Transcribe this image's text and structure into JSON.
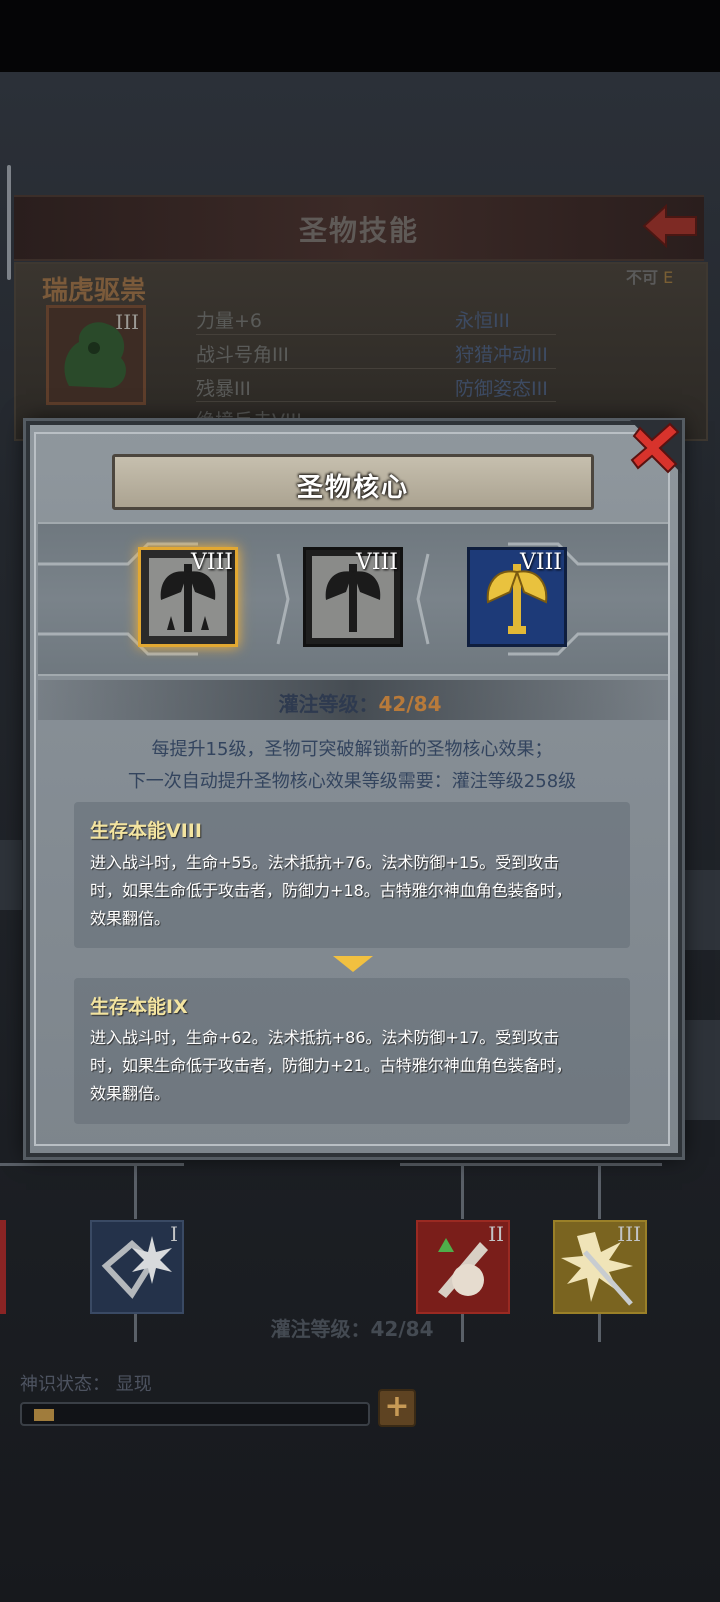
{
  "background_panel": {
    "title": "圣物技能",
    "relic_name": "瑞虎驱祟",
    "tag_prefix": "不可",
    "tag_grade": "E",
    "relic_level": "III",
    "stats_left": [
      "力量+6",
      "战斗号角III",
      "残暴III",
      "绝境反击VIII"
    ],
    "stats_right": [
      "永恒III",
      "狩猎冲动III",
      "防御姿态III"
    ]
  },
  "modal": {
    "title": "圣物核心",
    "cores": [
      {
        "level": "VIII",
        "selected": true,
        "icon": "axe-relic-icon"
      },
      {
        "level": "VIII",
        "selected": false,
        "icon": "axe-relic-icon"
      },
      {
        "level": "VIII",
        "selected": false,
        "icon": "golden-axe-relic-icon"
      }
    ],
    "infusion_label": "灌注等级：",
    "infusion_value": "42/84",
    "desc_line1": "每提升15级，圣物可突破解锁新的圣物核心效果；",
    "desc_line2": "下一次自动提升圣物核心效果等级需要：灌注等级258级",
    "current_effect": {
      "title": "生存本能VIII",
      "lines": [
        "进入战斗时，生命+55。法术抵抗+76。法术防御+15。受到攻击",
        "时，如果生命低于攻击者，防御力+18。古特雅尔神血角色装备时，",
        "效果翻倍。"
      ]
    },
    "next_effect": {
      "title": "生存本能IX",
      "lines": [
        "进入战斗时，生命+62。法术抵抗+86。法术防御+17。受到攻击",
        "时，如果生命低于攻击者，防御力+21。古特雅尔神血角色装备时，",
        "效果翻倍。"
      ]
    }
  },
  "bottom": {
    "skills": [
      {
        "level": "I",
        "icon": "shield-burst-icon"
      },
      {
        "level": "II",
        "icon": "sword-beast-icon"
      },
      {
        "level": "III",
        "icon": "spark-sword-icon"
      }
    ],
    "left_edge_level": "I",
    "right_edge_level": "III",
    "infusion_text": "灌注等级：42/84",
    "divine_label": "神识状态：",
    "divine_value": "显现",
    "divine_progress": 0.06,
    "plus_label": "+"
  },
  "colors": {
    "accent_gold": "#f3e4a0",
    "value_orange": "#b87a3a",
    "close_red": "#d8332c"
  }
}
